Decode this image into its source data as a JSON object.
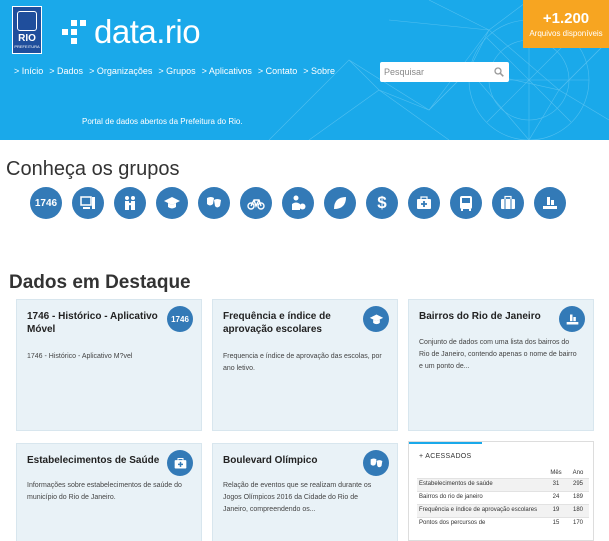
{
  "header": {
    "logo_text": "RIO",
    "logo_subtext": "PREFEITURA",
    "brand": "data.rio",
    "counter_value": "+1.200",
    "counter_label": "Arquivos disponíveis",
    "tagline": "Portal de dados abertos da Prefeitura do Rio.",
    "colors": {
      "header_bg": "#1aa9ea",
      "counter_bg": "#f7a521",
      "logo_bg": "#1f4e9c"
    }
  },
  "nav": [
    "> Início",
    "> Dados",
    "> Organizações",
    "> Grupos",
    "> Aplicativos",
    "> Contato",
    "> Sobre"
  ],
  "search": {
    "placeholder": "Pesquisar"
  },
  "groups": {
    "title": "Conheça os grupos",
    "items": [
      {
        "icon": "text-1746",
        "label": "1746"
      },
      {
        "icon": "computer-icon"
      },
      {
        "icon": "family-icon"
      },
      {
        "icon": "graduation-cap-icon"
      },
      {
        "icon": "theater-masks-icon"
      },
      {
        "icon": "bicycle-icon"
      },
      {
        "icon": "person-money-icon"
      },
      {
        "icon": "leaf-icon"
      },
      {
        "icon": "dollar-icon",
        "label": "$"
      },
      {
        "icon": "medical-kit-icon"
      },
      {
        "icon": "bus-icon"
      },
      {
        "icon": "suitcase-icon"
      },
      {
        "icon": "city-hand-icon"
      }
    ]
  },
  "featured": {
    "title": "Dados em Destaque",
    "cards": [
      {
        "title": "1746 - Histórico - Aplicativo Móvel",
        "desc": "1746 - Histórico - Aplicativo M?vel",
        "icon_label": "1746"
      },
      {
        "title": "Frequência e índice de aprovação escolares",
        "desc": "Frequencia e índice de aprovação das escolas, por ano letivo."
      },
      {
        "title": "Bairros do Rio de Janeiro",
        "desc": "Conjunto de dados com uma lista dos bairros do Rio de Janeiro, contendo apenas o nome de bairro e um ponto de..."
      },
      {
        "title": "Estabelecimentos de Saúde",
        "desc": "Informações sobre estabelecimentos de saúde do município do Rio de Janeiro."
      },
      {
        "title": "Boulevard Olímpico",
        "desc": "Relação de eventos que se realizam durante os Jogos Olímpicos 2016 da Cidade do Rio de Janeiro, compreendendo os..."
      }
    ]
  },
  "access": {
    "tab_label": "+ ACESSADOS",
    "col_month": "Mês",
    "col_year": "Ano",
    "rows": [
      {
        "name": "Estabelecimentos de saúde",
        "month": "31",
        "year": "295"
      },
      {
        "name": "Bairros do rio de janeiro",
        "month": "24",
        "year": "189"
      },
      {
        "name": "Frequência e índice de aprovação escolares",
        "month": "19",
        "year": "180"
      },
      {
        "name": "Pontos dos percursos de",
        "month": "15",
        "year": "170"
      }
    ]
  }
}
